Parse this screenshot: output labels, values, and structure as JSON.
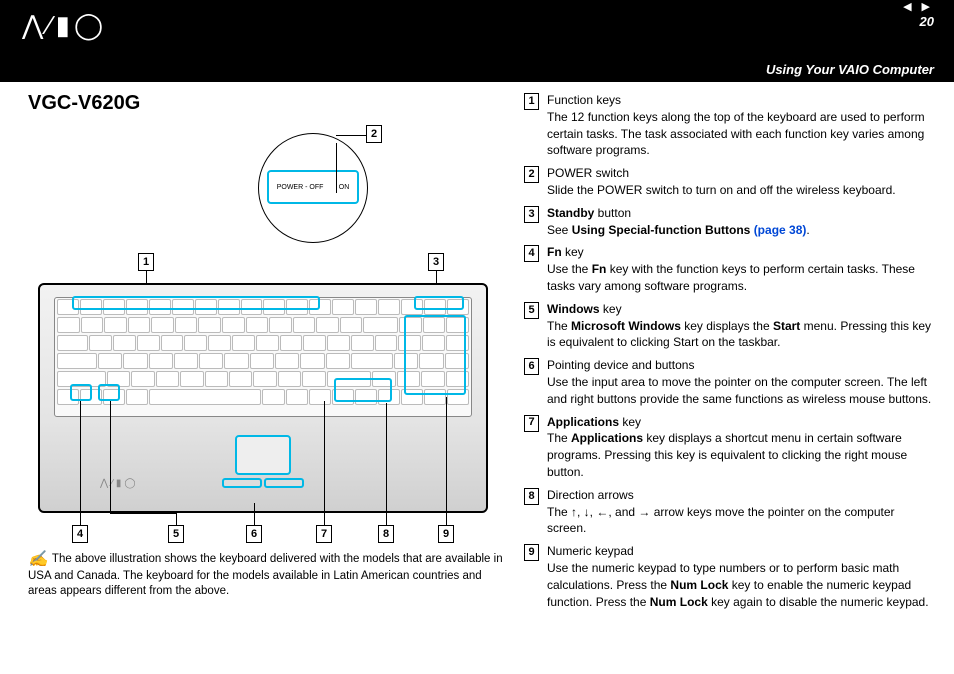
{
  "header": {
    "logo_text": "⋀∕▮◯",
    "page_number": "20",
    "nav_prev": "◀",
    "nav_next": "▶",
    "section_title": "Using Your VAIO Computer"
  },
  "title": "VGC-V620G",
  "inset": {
    "power_label": "POWER",
    "off": "OFF",
    "on": "ON"
  },
  "callouts_top": {
    "c1": "1",
    "c2": "2",
    "c3": "3"
  },
  "callouts_bottom": {
    "c4": "4",
    "c5": "5",
    "c6": "6",
    "c7": "7",
    "c8": "8",
    "c9": "9"
  },
  "vaio_mini": "⋀∕▮◯",
  "note_icon": "✍",
  "note": "The above illustration shows the keyboard delivered with the models that are available in USA and Canada. The keyboard for the models available in Latin American countries and areas appears different from the above.",
  "legend": [
    {
      "num": "1",
      "label": "Function keys",
      "label_bold": false,
      "desc": "The 12 function keys along the top of the keyboard are used to perform certain tasks. The task associated with each function key varies among software programs."
    },
    {
      "num": "2",
      "label": "POWER switch",
      "label_bold": false,
      "desc": "Slide the POWER switch to turn on and off the wireless keyboard."
    },
    {
      "num": "3",
      "label_html": "<span class='bold'>Standby</span> button",
      "desc_html": "See <span class='bold'>Using Special-function Buttons </span><span class='link'>(page 38)</span>."
    },
    {
      "num": "4",
      "label_html": "<span class='bold'>Fn</span> key",
      "desc_html": "Use the <span class='bold'>Fn</span> key with the function keys to perform certain tasks. These tasks vary among software programs."
    },
    {
      "num": "5",
      "label_html": "<span class='bold'>Windows</span> key",
      "desc_html": "The <span class='bold'>Microsoft Windows</span> key displays the <span class='bold'>Start</span> menu. Pressing this key is equivalent to clicking Start on the taskbar."
    },
    {
      "num": "6",
      "label": "Pointing device and buttons",
      "label_bold": false,
      "desc": "Use the input area to move the pointer on the computer screen. The left and right buttons provide the same functions as wireless mouse buttons."
    },
    {
      "num": "7",
      "label_html": "<span class='bold'>Applications</span> key",
      "desc_html": "The <span class='bold'>Applications</span> key displays a shortcut menu in certain software programs. Pressing this key is equivalent to clicking the right mouse button."
    },
    {
      "num": "8",
      "label": "Direction arrows",
      "label_bold": false,
      "desc_html": "The ↑, ↓, ←, and → arrow keys move the pointer on the computer screen."
    },
    {
      "num": "9",
      "label": "Numeric keypad",
      "label_bold": false,
      "desc_html": "Use the numeric keypad to type numbers or to perform basic math calculations. Press the <span class='bold'>Num Lock</span> key to enable the numeric keypad function. Press the <span class='bold'>Num Lock</span> key again to disable the numeric keypad."
    }
  ]
}
